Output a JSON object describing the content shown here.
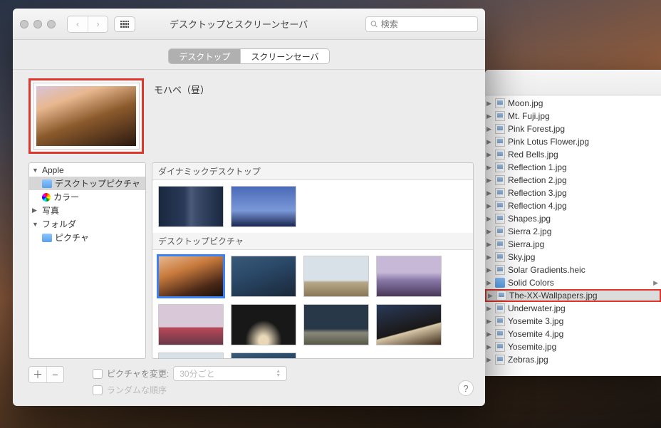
{
  "prefs": {
    "title": "デスクトップとスクリーンセーバ",
    "search_placeholder": "検索",
    "tabs": {
      "desktop": "デスクトップ",
      "screensaver": "スクリーンセーバ"
    },
    "preview_label": "モハベ（昼）",
    "sidebar": {
      "apple": "Apple",
      "desktop_pictures": "デスクトップピクチャ",
      "colors": "カラー",
      "photos": "写真",
      "folders": "フォルダ",
      "pictures": "ピクチャ"
    },
    "sections": {
      "dynamic": "ダイナミックデスクトップ",
      "pictures": "デスクトップピクチャ"
    },
    "bottom": {
      "change_picture": "ピクチャを変更:",
      "interval": "30分ごと",
      "random": "ランダムな順序"
    }
  },
  "finder": {
    "files": [
      "Moon.jpg",
      "Mt. Fuji.jpg",
      "Pink Forest.jpg",
      "Pink Lotus Flower.jpg",
      "Red Bells.jpg",
      "Reflection 1.jpg",
      "Reflection 2.jpg",
      "Reflection 3.jpg",
      "Reflection 4.jpg",
      "Shapes.jpg",
      "Sierra 2.jpg",
      "Sierra.jpg",
      "Sky.jpg",
      "Solar Gradients.heic",
      "Solid Colors",
      "The-XX-Wallpapers.jpg",
      "Underwater.jpg",
      "Yosemite 3.jpg",
      "Yosemite 4.jpg",
      "Yosemite.jpg",
      "Zebras.jpg"
    ],
    "folder_index": 14,
    "highlighted_index": 15,
    "selected_index": 15
  }
}
